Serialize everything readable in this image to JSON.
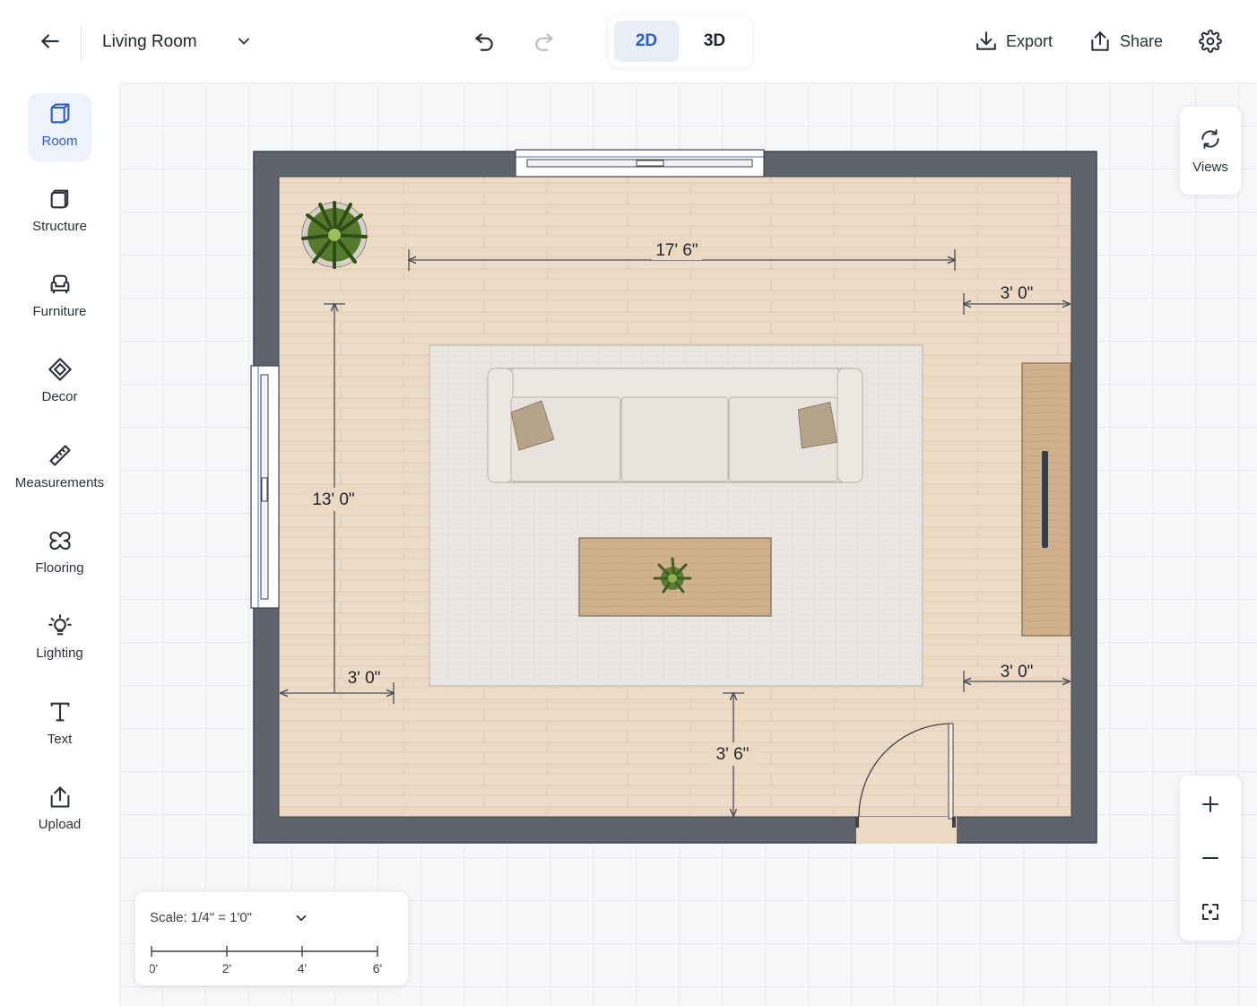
{
  "header": {
    "room_name": "Living Room",
    "view_modes": [
      "2D",
      "3D"
    ],
    "active_view": "2D",
    "export_label": "Export",
    "share_label": "Share"
  },
  "sidebar": {
    "items": [
      {
        "label": "Room",
        "icon": "cube-icon",
        "active": true
      },
      {
        "label": "Structure",
        "icon": "structure-icon",
        "active": false
      },
      {
        "label": "Furniture",
        "icon": "armchair-icon",
        "active": false
      },
      {
        "label": "Decor",
        "icon": "diamond-icon",
        "active": false
      },
      {
        "label": "Measurements",
        "icon": "ruler-icon",
        "active": false
      },
      {
        "label": "Flooring",
        "icon": "flooring-icon",
        "active": false
      },
      {
        "label": "Lighting",
        "icon": "lightbulb-icon",
        "active": false
      },
      {
        "label": "Text",
        "icon": "text-icon",
        "active": false
      },
      {
        "label": "Upload",
        "icon": "upload-icon",
        "active": false
      }
    ]
  },
  "canvas": {
    "views_label": "Views",
    "scale": {
      "label": "Scale: 1/4\" = 1'0\"",
      "ticks": [
        "0'",
        "2'",
        "4'",
        "6'"
      ]
    },
    "dimensions": {
      "sofa_width": "17' 6\"",
      "tv_clearance": "3' 0\"",
      "wall_height": "13' 0\"",
      "left_clearance": "3' 0\"",
      "right_clearance": "3' 0\"",
      "door_clearance": "3' 6\""
    }
  },
  "colors": {
    "accent": "#2c5bd0",
    "wall": "#5f636b",
    "floor": "#ecd9c3",
    "rug": "#e9e6e2",
    "wood": "#cdb08b"
  }
}
